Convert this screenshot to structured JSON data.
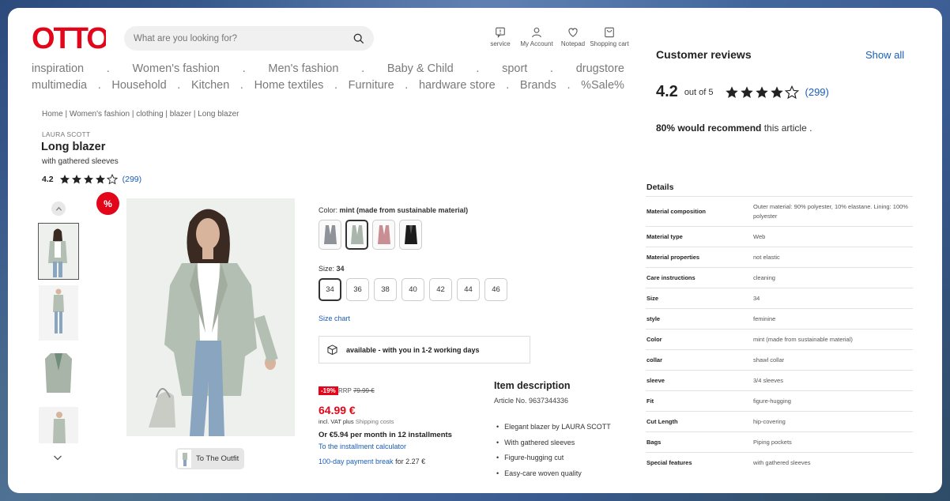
{
  "logo": "OTTO",
  "search": {
    "placeholder": "What are you looking for?"
  },
  "header_icons": [
    {
      "label": "service",
      "icon": "service-icon"
    },
    {
      "label": "My Account",
      "icon": "account-icon"
    },
    {
      "label": "Notepad",
      "icon": "heart-icon"
    },
    {
      "label": "Shopping cart",
      "icon": "cart-icon"
    }
  ],
  "nav": {
    "row1": [
      "inspiration",
      "Women's fashion",
      "Men's fashion",
      "Baby & Child",
      "sport",
      "drugstore"
    ],
    "row2": [
      "multimedia",
      "Household",
      "Kitchen",
      "Home textiles",
      "Furniture",
      "hardware store",
      "Brands",
      "%Sale%"
    ]
  },
  "breadcrumb": "Home | Women's fashion | clothing | blazer | Long blazer",
  "product": {
    "brand": "LAURA SCOTT",
    "title": "Long blazer",
    "subtitle": "with gathered sleeves",
    "rating": "4.2",
    "rating_value": 4.2,
    "review_count": "(299)",
    "sale_badge": "%",
    "outfit_label": "To The Outfit"
  },
  "color": {
    "label": "Color:",
    "value": "mint (made from sustainable material)",
    "swatches": [
      "#8e9299",
      "#aab5ab",
      "#c98e93",
      "#1c1c1c"
    ],
    "selected": 1
  },
  "size": {
    "label": "Size:",
    "value": "34",
    "options": [
      "34",
      "36",
      "38",
      "40",
      "42",
      "44",
      "46"
    ],
    "selected": 0
  },
  "size_chart": "Size chart",
  "availability": "available - with you in 1-2 working days",
  "price": {
    "discount": "-19%",
    "rrp_label": "RRP",
    "rrp_value": "79.99 €",
    "current": "64.99 €",
    "vat": "incl. VAT plus",
    "shipping": "Shipping costs",
    "installments": "Or €5.94 per month in 12 installments",
    "calculator": "To the installment calculator",
    "paybreak_link": "100-day payment break",
    "paybreak_rest": "for 2.27 €"
  },
  "description": {
    "heading": "Item description",
    "article": "Article No. 9637344336",
    "bullets": [
      "Elegant blazer by LAURA SCOTT",
      "With gathered sleeves",
      "Figure-hugging cut",
      "Easy-care woven quality"
    ]
  },
  "reviews": {
    "heading": "Customer reviews",
    "show_all": "Show all",
    "score": "4.2",
    "out_of": "out of 5",
    "count": "(299)",
    "recommend_bold": "80% would recommend",
    "recommend_rest": "this article ."
  },
  "details": {
    "heading": "Details",
    "rows": [
      {
        "k": "Material composition",
        "v": "Outer material: 90% polyester, 10% elastane. Lining: 100% polyester"
      },
      {
        "k": "Material type",
        "v": "Web"
      },
      {
        "k": "Material properties",
        "v": "not elastic"
      },
      {
        "k": "Care instructions",
        "v": "cleaning"
      },
      {
        "k": "Size",
        "v": "34"
      },
      {
        "k": "style",
        "v": "feminine"
      },
      {
        "k": "Color",
        "v": "mint (made from sustainable material)"
      },
      {
        "k": "collar",
        "v": "shawl collar"
      },
      {
        "k": "sleeve",
        "v": "3/4 sleeves"
      },
      {
        "k": "Fit",
        "v": "figure-hugging"
      },
      {
        "k": "Cut Length",
        "v": "hip-covering"
      },
      {
        "k": "Bags",
        "v": "Piping pockets"
      },
      {
        "k": "Special features",
        "v": "with gathered sleeves"
      }
    ]
  },
  "colors": {
    "brand_red": "#e3061b",
    "link_blue": "#1a5db8"
  }
}
